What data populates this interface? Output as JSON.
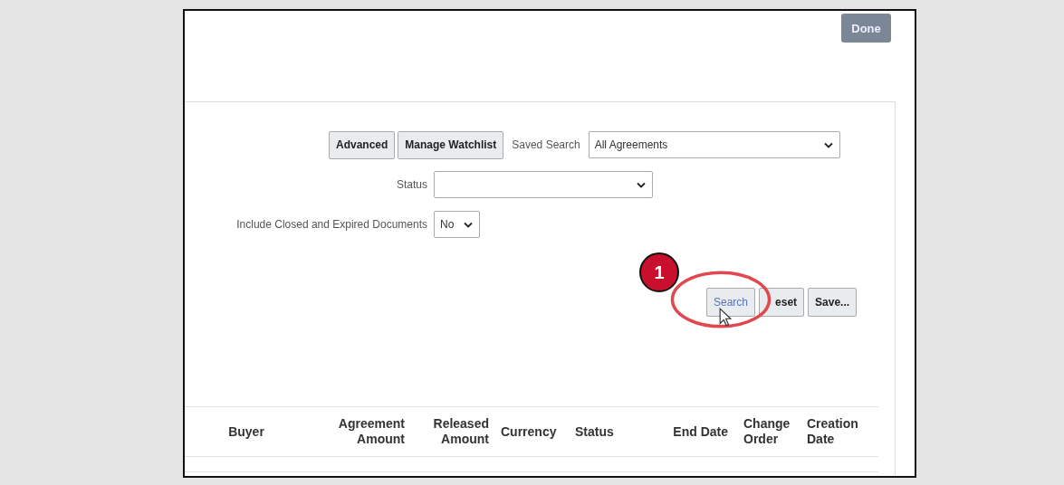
{
  "header": {
    "done_button": "Done"
  },
  "search_panel": {
    "top_buttons": [
      "Advanced",
      "Manage Watchlist"
    ],
    "saved_search": {
      "label": "Saved Search",
      "value": "All Agreements"
    },
    "fields": [
      {
        "label": "Status",
        "kind": "wide"
      },
      {
        "label": "Include Closed and Expired Documents",
        "value": "No",
        "kind": "narrow"
      }
    ],
    "action_buttons": [
      {
        "label": "Search",
        "highlighted": true
      },
      {
        "label": "eset",
        "highlighted": false
      },
      {
        "label": "Save...",
        "highlighted": false
      }
    ]
  },
  "callout": {
    "number": "1"
  },
  "table": {
    "columns": [
      {
        "label": "Buyer"
      },
      {
        "label": "Agreement Amount"
      },
      {
        "label": "Released Amount"
      },
      {
        "label": "Currency"
      },
      {
        "label": "Status"
      },
      {
        "label": "End Date"
      },
      {
        "label": "Change Order"
      },
      {
        "label": "Creation Date"
      }
    ]
  }
}
